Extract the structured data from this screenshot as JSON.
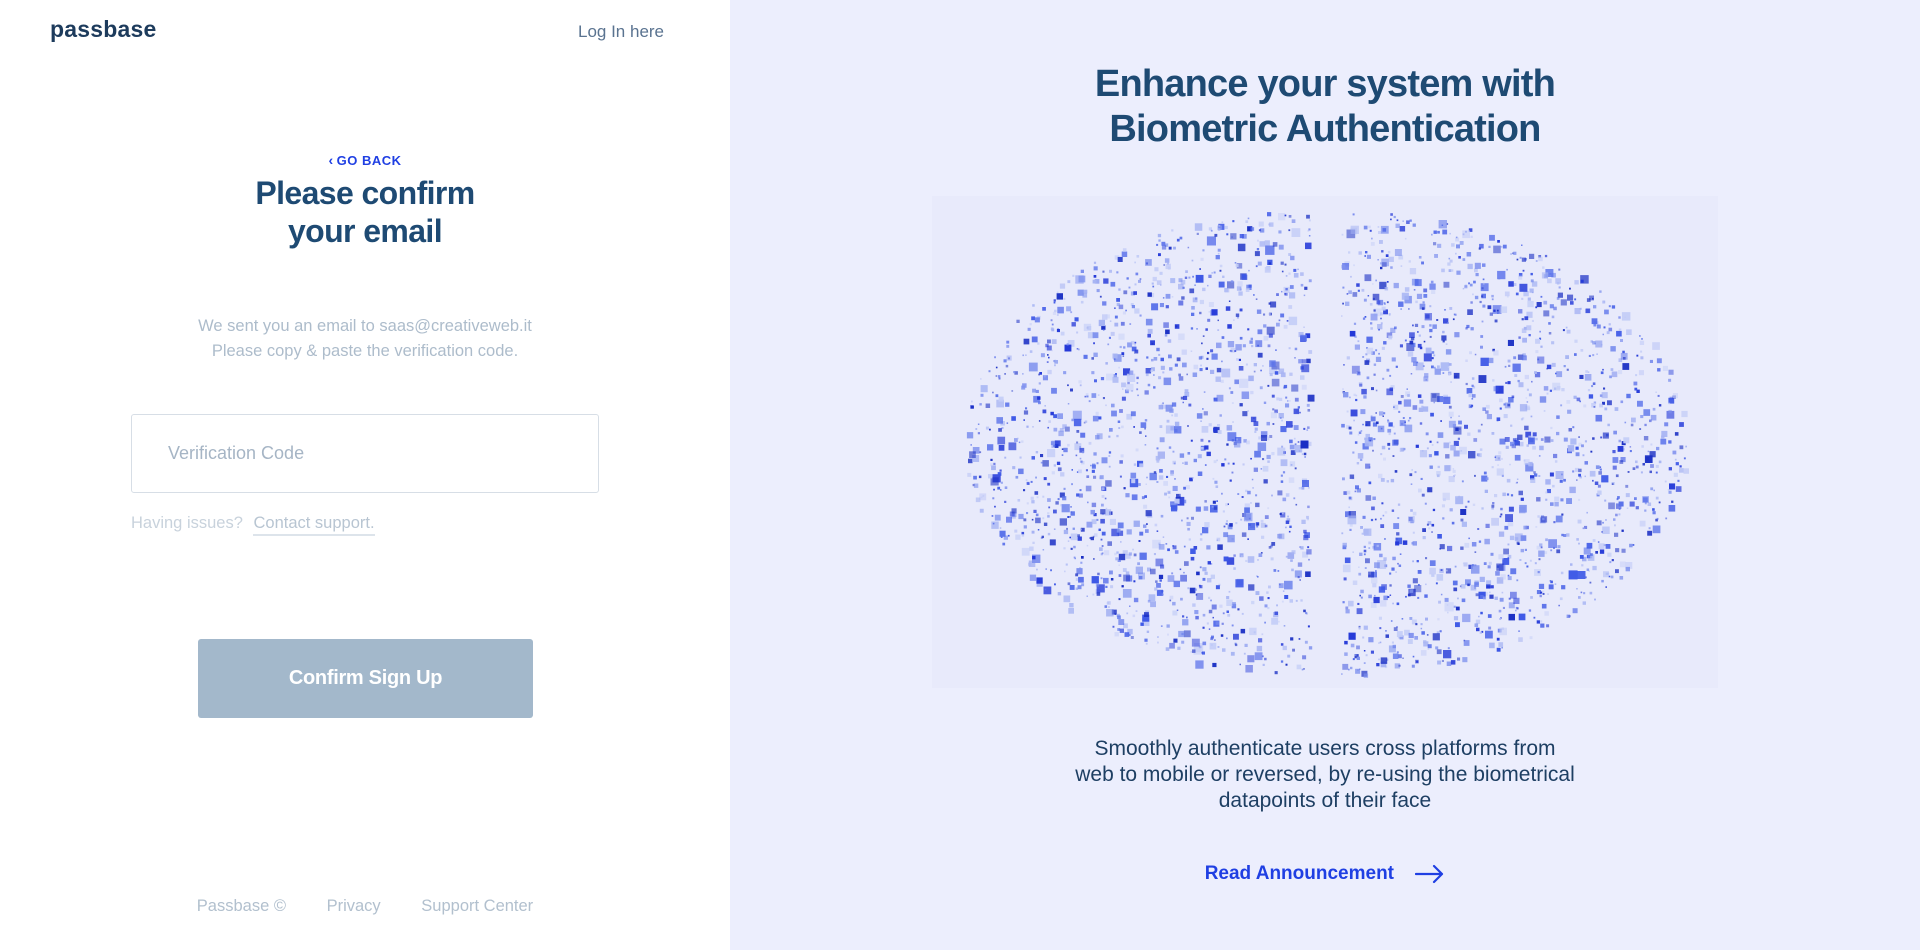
{
  "header": {
    "logo": "passbase",
    "login_label": "Log In here"
  },
  "form": {
    "go_back_label": "GO BACK",
    "title_line1": "Please confirm",
    "title_line2": "your email",
    "info_line1": "We sent you an email to saas@creativeweb.it",
    "info_line2": "Please copy & paste the verification code.",
    "code_value": "",
    "code_placeholder": "Verification Code",
    "issues_label": "Having issues?",
    "contact_label": "Contact support.",
    "confirm_label": "Confirm Sign Up"
  },
  "footer": {
    "copyright": "Passbase ©",
    "privacy": "Privacy",
    "support": "Support Center"
  },
  "promo": {
    "title_line1": "Enhance your system with",
    "title_line2": "Biometric Authentication",
    "desc_line1": "Smoothly authenticate users cross platforms from",
    "desc_line2": "web to mobile or reversed, by re-using the biometrical",
    "desc_line3": "datapoints of their face",
    "cta_label": "Read Announcement",
    "cta_icon": "arrow-right-icon"
  },
  "colors": {
    "brand_blue": "#1f3fe3",
    "heading_navy": "#1e4a73",
    "panel_bg": "#eceefd",
    "button_disabled": "#a3b8cb"
  }
}
